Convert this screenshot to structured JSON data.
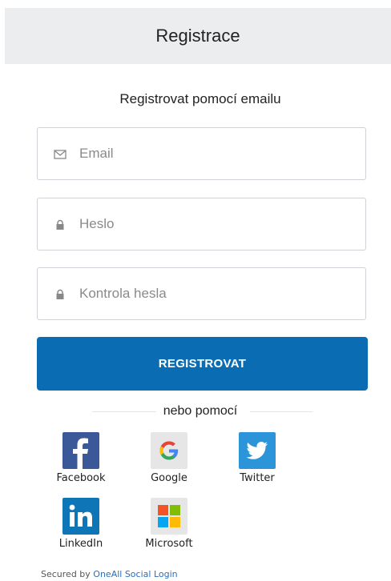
{
  "header": {
    "title": "Registrace"
  },
  "form": {
    "subtitle": "Registrovat pomocí emailu",
    "email_placeholder": "Email",
    "password_placeholder": "Heslo",
    "password_confirm_placeholder": "Kontrola hesla",
    "submit_label": "REGISTROVAT"
  },
  "divider": {
    "text": "nebo pomocí"
  },
  "social": {
    "facebook": "Facebook",
    "google": "Google",
    "twitter": "Twitter",
    "linkedin": "LinkedIn",
    "microsoft": "Microsoft"
  },
  "footer": {
    "prefix": "Secured by",
    "link": "OneAll Social Login"
  },
  "colors": {
    "accent": "#0a6db4",
    "header_bg": "#ecedef"
  }
}
